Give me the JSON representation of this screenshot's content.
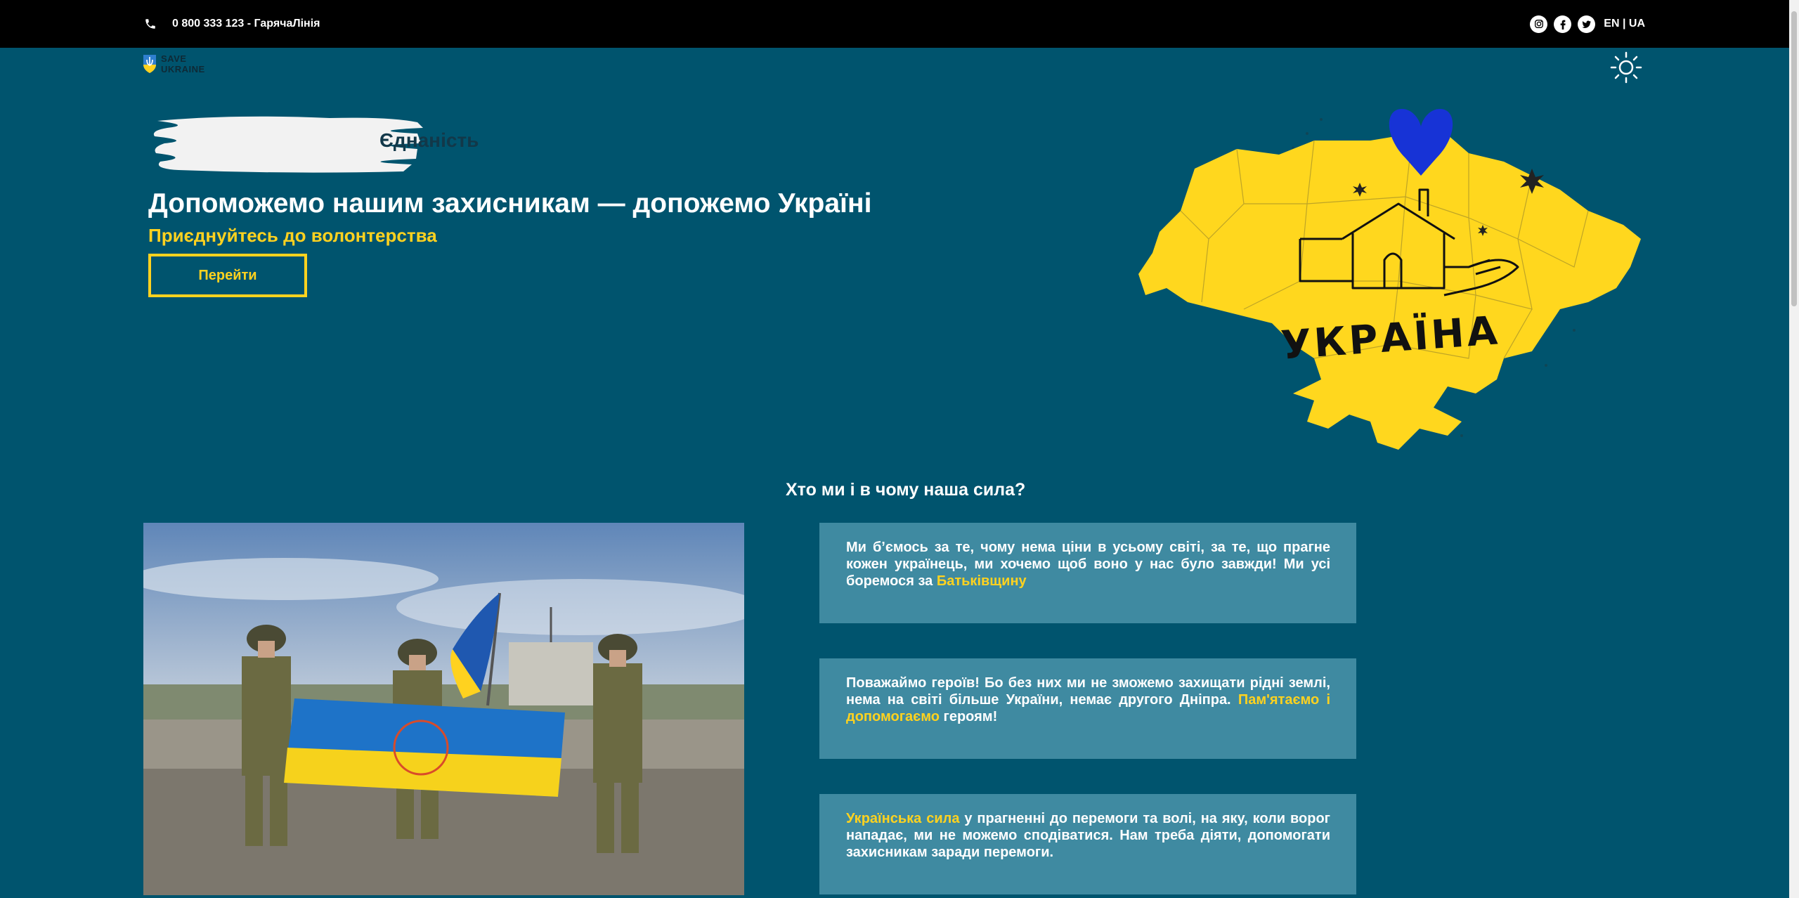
{
  "topbar": {
    "phone_text": "0 800 333 123 - ГарячаЛінія",
    "social": [
      {
        "icon": "instagram-icon",
        "glyph": "◎"
      },
      {
        "icon": "facebook-icon",
        "glyph": "f"
      },
      {
        "icon": "twitter-icon",
        "glyph": "✦"
      }
    ],
    "lang": "EN | UA"
  },
  "logo": {
    "line1": "SAVE",
    "line2": "UKRAINE"
  },
  "hero": {
    "brush_word": "Єдна",
    "brush_word_suffix": "ність",
    "unity_text": "Єднаність",
    "title": "Допоможемо нашим захисникам — допожемо Україні",
    "subtitle": "Приєднуйтесь до волонтерства",
    "button_label": "Перейти",
    "map_label": "УКРАЇНА"
  },
  "about": {
    "title": "Хто ми і в чому наша сила?",
    "cards": [
      {
        "text": "Ми б’ємось за те, чому нема ціни в усьому світі, за те, що прагне кожен українець, ми хочемо щоб воно у нас було завжди! Ми усі боремося за ",
        "highlight": "Батьківщину",
        "after": ""
      },
      {
        "text": "Поважаймо героїв! Бо без них ми не зможемо захищати рідні землі, нема на світі більше України, немає другого Дніпра. ",
        "highlight": "Пам'ятаємо і допомогаємо",
        "after": " героям!"
      },
      {
        "text": "",
        "highlight": "Українська сила",
        "after": " у прагненні до перемоги та волі, на яку, коли ворог нападає, ми не можемо сподіватися. Нам треба діяти, допомогати захисникам заради перемоги."
      }
    ]
  },
  "colors": {
    "background": "#00546e",
    "accent": "#ffd21f",
    "card": "#3f8aa1",
    "topbar": "#000000"
  }
}
